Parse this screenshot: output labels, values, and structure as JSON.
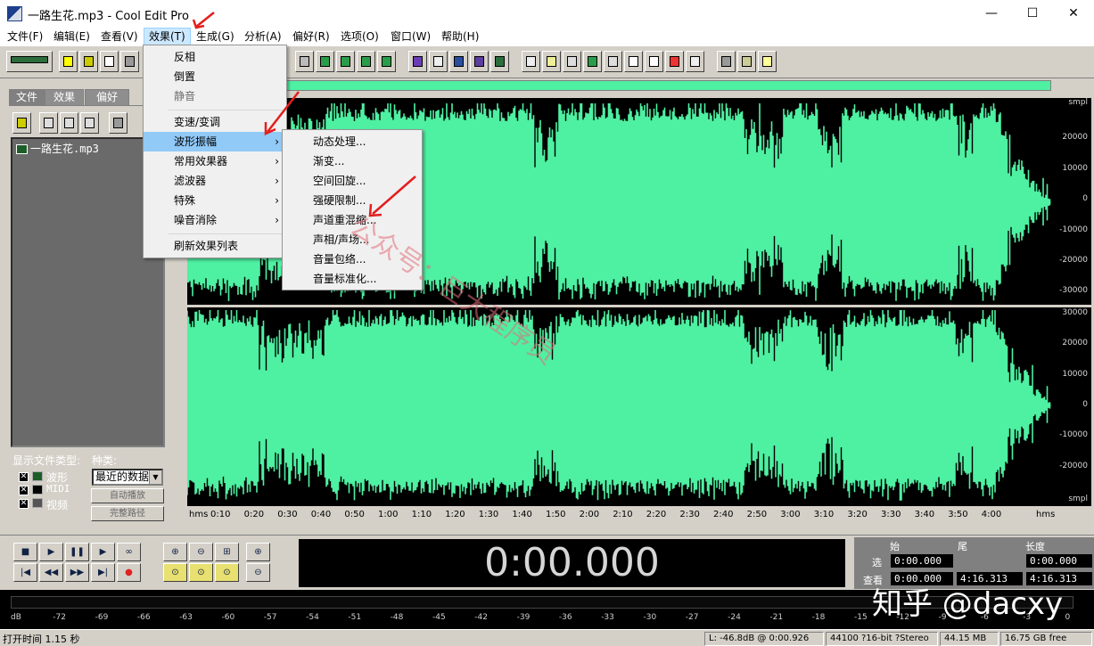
{
  "window": {
    "title": "一路生花.mp3 - Cool Edit Pro",
    "minimize": "—",
    "maximize": "☐",
    "close": "✕"
  },
  "menubar": {
    "items": [
      "文件(F)",
      "编辑(E)",
      "查看(V)",
      "效果(T)",
      "生成(G)",
      "分析(A)",
      "偏好(R)",
      "选项(O)",
      "窗口(W)",
      "帮助(H)"
    ]
  },
  "left_panel": {
    "tabs": [
      "文件",
      "效果",
      "偏好"
    ],
    "files": [
      "一路生花.mp3"
    ],
    "file_type_label": "显示文件类型:",
    "kind_label": "种类:",
    "types": [
      "波形",
      "MIDI",
      "视频"
    ],
    "sort_select": "最近的数据",
    "auto_play": "自动播放",
    "full_path": "完整路径"
  },
  "effects_menu": {
    "items": [
      "反相",
      "倒置",
      "静音",
      "变速/变调",
      "波形振幅",
      "常用效果器",
      "滤波器",
      "特殊",
      "噪音消除",
      "刷新效果列表"
    ],
    "disabled": [
      "静音"
    ],
    "submenu_arrow": "›"
  },
  "amplitude_submenu": {
    "items": [
      "动态处理...",
      "渐变...",
      "空间回旋...",
      "强硬限制...",
      "声道重混缩...",
      "声相/声场...",
      "音量包络...",
      "音量标准化..."
    ]
  },
  "waveform": {
    "color": "#4ef0a2",
    "y_labels_top": [
      "smpl",
      "20000",
      "10000",
      "0",
      "-10000",
      "-20000",
      "-30000"
    ],
    "y_labels_bottom": [
      "30000",
      "20000",
      "10000",
      "0",
      "-10000",
      "-20000",
      "smpl"
    ],
    "time_labels": [
      "hms",
      "0:10",
      "0:20",
      "0:30",
      "0:40",
      "0:50",
      "1:00",
      "1:10",
      "1:20",
      "1:30",
      "1:40",
      "1:50",
      "2:00",
      "2:10",
      "2:20",
      "2:30",
      "2:40",
      "2:50",
      "3:00",
      "3:10",
      "3:20",
      "3:30",
      "3:40",
      "3:50",
      "4:00",
      "hms"
    ]
  },
  "transport": {
    "time": "0:00.000",
    "play_icons": [
      "■",
      "▶",
      "❚❚",
      "▶",
      "∞",
      "|◀",
      "◀◀",
      "▶▶",
      "▶|",
      "●"
    ]
  },
  "selection": {
    "headers": [
      "始",
      "尾",
      "长度"
    ],
    "row_labels": [
      "选",
      "查看"
    ],
    "select_row": [
      "0:00.000",
      "",
      "0:00.000"
    ],
    "view_row": [
      "0:00.000",
      "4:16.313",
      "4:16.313"
    ]
  },
  "meter": {
    "labels": [
      "dB",
      "-72",
      "-69",
      "-66",
      "-63",
      "-60",
      "-57",
      "-54",
      "-51",
      "-48",
      "-45",
      "-42",
      "-39",
      "-36",
      "-33",
      "-30",
      "-27",
      "-24",
      "-21",
      "-18",
      "-15",
      "-12",
      "-9",
      "-6",
      "-3",
      "0"
    ]
  },
  "status": {
    "open_time": "打开时间 1.15 秒",
    "level": "L: -46.8dB @  0:00.926",
    "format": "44100 ?16-bit ?Stereo",
    "size": "44.15 MB",
    "free": "16.75 GB free"
  },
  "watermarks": {
    "diagonal": "公众号：巨大程序员",
    "corner": "知乎 @dacxy"
  }
}
